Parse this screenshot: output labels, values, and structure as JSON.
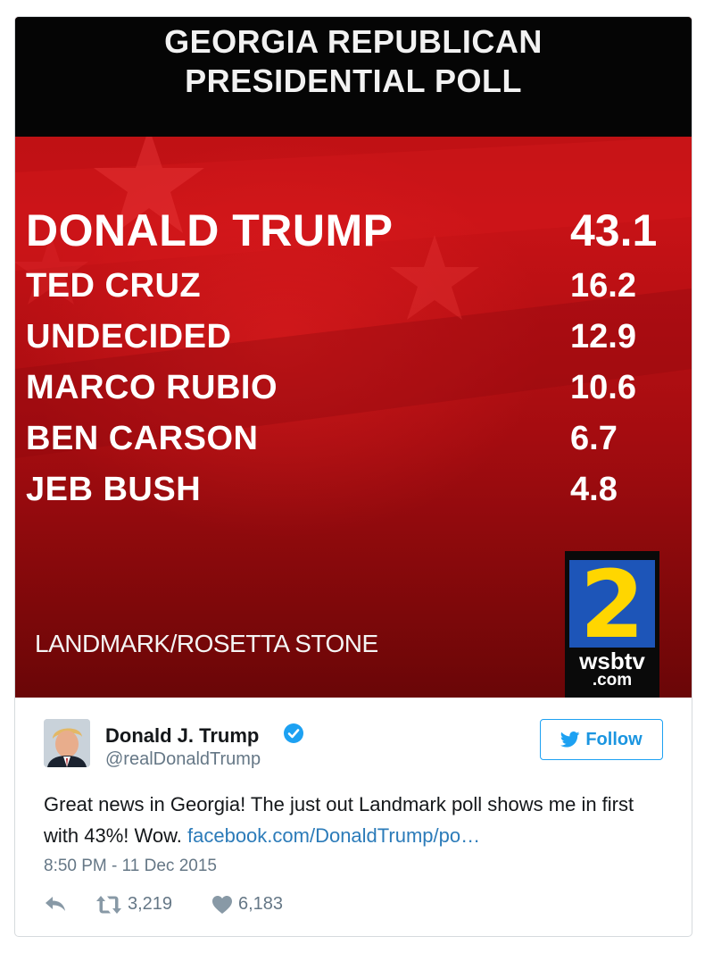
{
  "poll": {
    "title_line1": "GEORGIA REPUBLICAN",
    "title_line2": "PRESIDENTIAL POLL",
    "results": [
      {
        "name": "DONALD TRUMP",
        "value": "43.1"
      },
      {
        "name": "TED CRUZ",
        "value": "16.2"
      },
      {
        "name": "UNDECIDED",
        "value": "12.9"
      },
      {
        "name": "MARCO RUBIO",
        "value": "10.6"
      },
      {
        "name": "BEN CARSON",
        "value": "6.7"
      },
      {
        "name": "JEB BUSH",
        "value": "4.8"
      }
    ],
    "source": "LANDMARK/ROSETTA STONE",
    "logo_number": "2",
    "logo_brand": "wsbtv",
    "logo_domain": ".com"
  },
  "tweet": {
    "display_name": "Donald J. Trump",
    "handle": "@realDonaldTrump",
    "follow_label": "Follow",
    "text": "Great news in Georgia! The just out Landmark poll shows me in first with 43%! Wow. ",
    "link_text": "facebook.com/DonaldTrump/po…",
    "timestamp": "8:50 PM - 11 Dec 2015",
    "retweet_count": "3,219",
    "like_count": "6,183"
  },
  "colors": {
    "twitter_blue": "#1da1f2",
    "link": "#2b7bb9",
    "muted": "#657786",
    "poll_red": "#c71216",
    "logo_blue": "#1d55b8",
    "logo_yellow": "#ffd600"
  },
  "icons": [
    "verified-badge-icon",
    "twitter-bird-icon",
    "reply-icon",
    "retweet-icon",
    "heart-icon"
  ]
}
